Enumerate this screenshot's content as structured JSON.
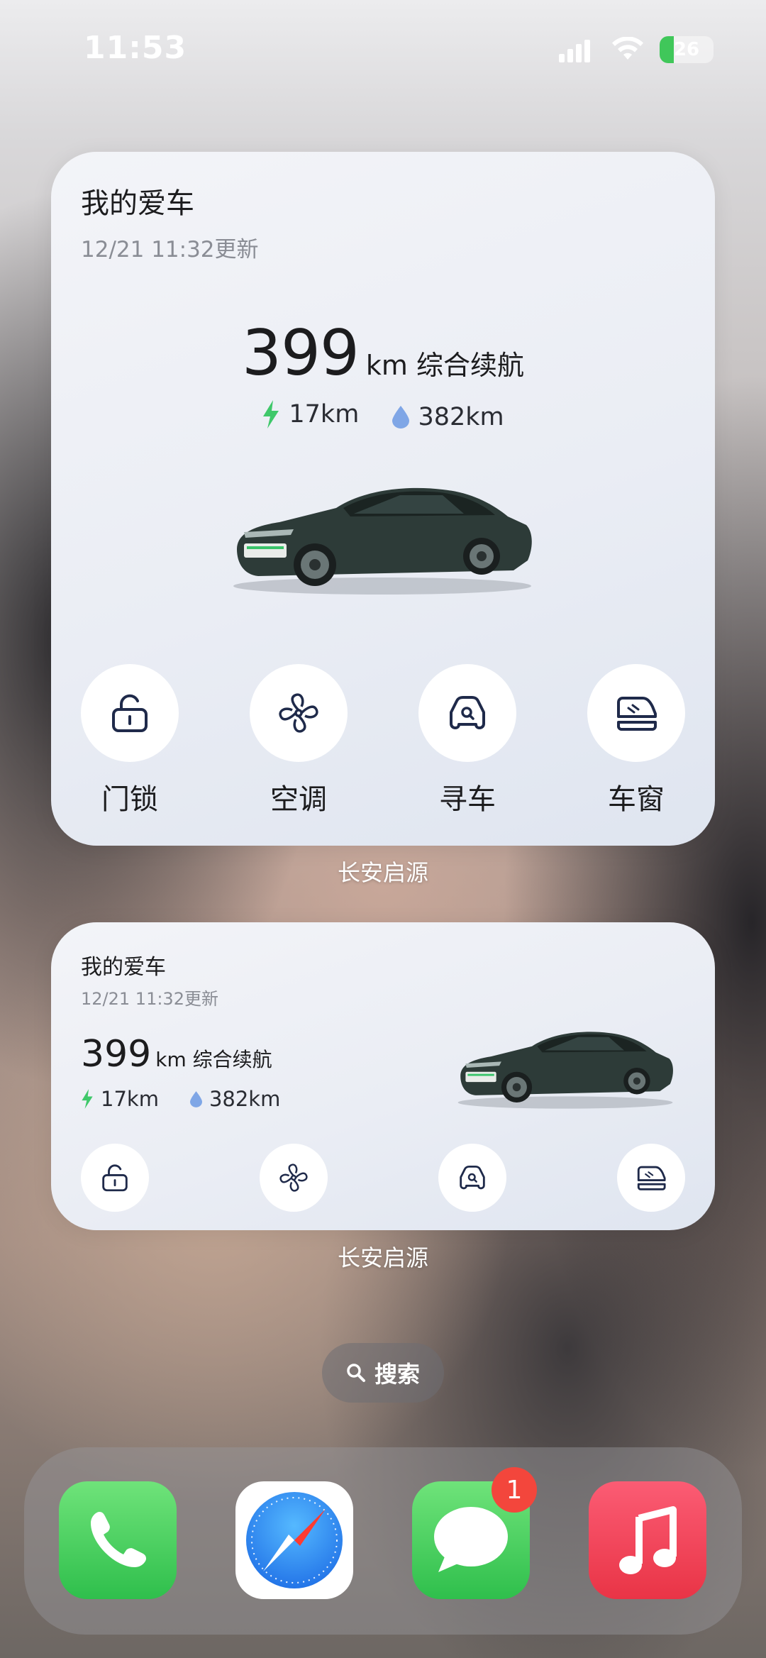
{
  "status_bar": {
    "time": "11:53",
    "battery_level": "26",
    "battery_charging": true
  },
  "large_widget": {
    "title": "我的爱车",
    "updated": "12/21 11:32更新",
    "range_value": "399",
    "range_unit": "km 综合续航",
    "electric_range": "17km",
    "fuel_range": "382km",
    "actions": [
      {
        "label": "门锁",
        "icon": "lock-icon"
      },
      {
        "label": "空调",
        "icon": "fan-icon"
      },
      {
        "label": "寻车",
        "icon": "find-car-icon"
      },
      {
        "label": "车窗",
        "icon": "car-window-icon"
      }
    ],
    "app_name": "长安启源"
  },
  "medium_widget": {
    "title": "我的爱车",
    "updated": "12/21 11:32更新",
    "range_value": "399",
    "range_unit": "km 综合续航",
    "electric_range": "17km",
    "fuel_range": "382km",
    "app_name": "长安启源"
  },
  "search": {
    "label": "搜索"
  },
  "dock": {
    "apps": [
      {
        "name": "Phone",
        "icon": "phone-icon"
      },
      {
        "name": "Safari",
        "icon": "compass-icon"
      },
      {
        "name": "Messages",
        "icon": "chat-bubble-icon",
        "badge": "1"
      },
      {
        "name": "Music",
        "icon": "music-note-icon"
      }
    ]
  },
  "colors": {
    "electric_green": "#3fc86a",
    "fuel_blue": "#7fa6e6",
    "icon_navy": "#1f2a4a",
    "badge_red": "#f3463c"
  }
}
